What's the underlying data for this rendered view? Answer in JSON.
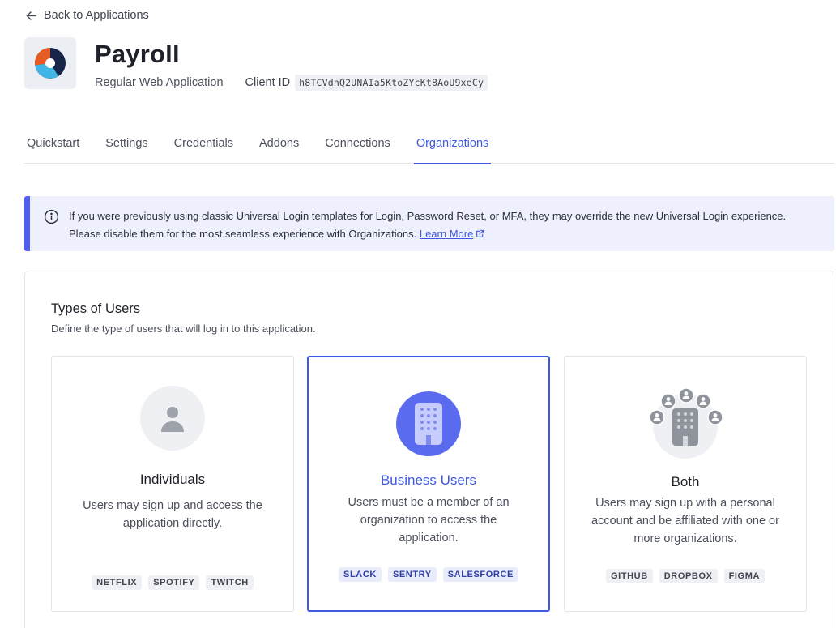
{
  "nav": {
    "back_label": "Back to Applications"
  },
  "app": {
    "name": "Payroll",
    "type": "Regular Web Application",
    "client_id_label": "Client ID",
    "client_id": "h8TCVdnQ2UNAIa5KtoZYcKt8AoU9xeCy"
  },
  "tabs": [
    {
      "label": "Quickstart",
      "active": false
    },
    {
      "label": "Settings",
      "active": false
    },
    {
      "label": "Credentials",
      "active": false
    },
    {
      "label": "Addons",
      "active": false
    },
    {
      "label": "Connections",
      "active": false
    },
    {
      "label": "Organizations",
      "active": true
    }
  ],
  "banner": {
    "text": "If you were previously using classic Universal Login templates for Login, Password Reset, or MFA, they may override the new Universal Login experience. Please disable them for the most seamless experience with Organizations.",
    "link_label": "Learn More"
  },
  "types": {
    "title": "Types of Users",
    "description": "Define the type of users that will log in to this application.",
    "cards": [
      {
        "title": "Individuals",
        "description": "Users may sign up and access the application directly.",
        "chips": [
          "NETFLIX",
          "SPOTIFY",
          "TWITCH"
        ],
        "selected": false,
        "icon": "person-icon"
      },
      {
        "title": "Business Users",
        "description": "Users must be a member of an organization to access the application.",
        "chips": [
          "SLACK",
          "SENTRY",
          "SALESFORCE"
        ],
        "selected": true,
        "icon": "building-icon"
      },
      {
        "title": "Both",
        "description": "Users may sign up with a personal account and be affiliated with one or more organizations.",
        "chips": [
          "GITHUB",
          "DROPBOX",
          "FIGMA"
        ],
        "selected": false,
        "icon": "building-with-people-icon"
      }
    ]
  },
  "colors": {
    "accent": "#3f59e4",
    "banner_bg": "#eef0fd",
    "banner_bar": "#4e5ef0",
    "selected_icon_bg": "#5b6bf0"
  }
}
